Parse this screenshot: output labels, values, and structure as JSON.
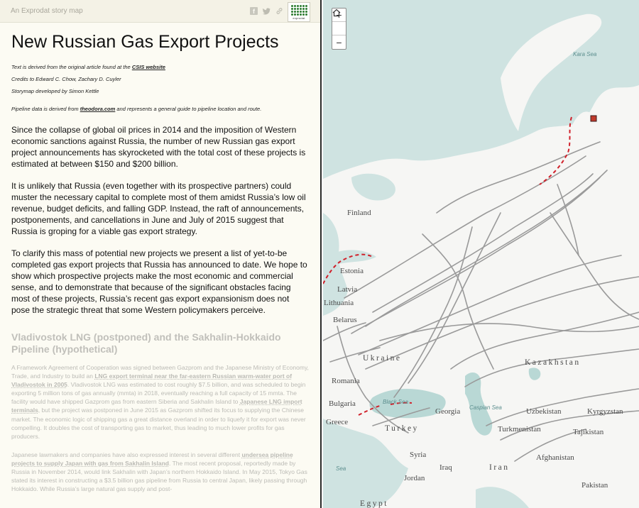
{
  "header": {
    "brand": "An Exprodat story map",
    "share_icons": [
      "facebook-icon",
      "twitter-icon",
      "link-icon"
    ],
    "logo_text": "exprodat"
  },
  "story": {
    "title": "New Russian Gas Export Projects",
    "credit_lines": {
      "source_prefix": "Text is derived from the original article found at the ",
      "source_link": "CSIS website",
      "credits": "Credits to Edward C. Chow, Zachary D. Cuyler",
      "developer": "Storymap developed by Simon Kettle"
    },
    "pipeline_note": {
      "prefix": "Pipeline data is derived from ",
      "link": "theodora.com",
      "suffix": " and represents a general guide to pipeline location and route."
    },
    "paragraphs": [
      "Since the collapse of global oil prices in 2014 and the imposition of Western economic sanctions against Russia, the number of new Russian gas export project announcements has skyrocketed with the total cost of these projects is estimated at between $150 and $200 billion.",
      "It is unlikely that Russia (even together with its prospective partners) could muster the necessary capital to complete most of them amidst Russia’s low oil revenue, budget deficits, and falling GDP. Instead, the raft of announcements, postponements, and cancellations in June and July of 2015 suggest that Russia is groping for a viable gas export strategy.",
      "To clarify this mass of potential new projects we present a list of yet-to-be completed gas export projects that Russia has announced to date. We hope to show which prospective projects make the most economic and commercial sense, and to demonstrate that because of the significant obstacles facing most of these projects, Russia’s recent gas export expansionism does not pose the strategic threat that some Western policymakers perceive."
    ],
    "section": {
      "title": "Vladivostok LNG (postponed) and the Sakhalin-Hokkaido Pipeline (hypothetical)",
      "p1": {
        "a": "A Framework Agreement of Cooperation was signed between Gazprom and the Japanese Ministry of Economy, Trade, and Industry to build an ",
        "link1": "LNG export terminal near the far-eastern Russian warm-water port of Vladivostok in 2005",
        "b": ". Vladivostok LNG was estimated to cost roughly $7.5 billion, and was scheduled to begin exporting 5 million tons of gas annually (mmta) in 2018, eventually reaching a full capacity of 15 mmta. The facility would have shipped Gazprom gas from eastern Siberia and Sakhalin Island to ",
        "link2": "Japanese LNG import terminals",
        "c": ", but the project was postponed in June 2015 as Gazprom shifted its focus to supplying the Chinese market. The economic logic of shipping gas a great distance overland in order to liquefy it for export was never compelling. It doubles the cost of transporting gas to market, thus leading to much lower profits for gas producers."
      },
      "p2": {
        "a": "Japanese lawmakers and companies have also expressed interest in several different ",
        "link1": "undersea pipeline projects to supply Japan with gas from Sakhalin Island",
        "b": ". The most recent proposal, reportedly made by Russia in November 2014, would link Sakhalin with Japan’s northern Hokkaido Island. In May 2015, Tokyo Gas stated its interest in constructing a $3.5 billion gas pipeline from Russia to central Japan, likely passing through Hokkaido. While Russia’s large natural gas supply and post-"
      }
    }
  },
  "map": {
    "zoom_in": "+",
    "home_icon": "home-icon",
    "zoom_out": "−",
    "labels": {
      "kara_sea": "Kara Sea",
      "finland": "Finland",
      "estonia": "Estonia",
      "latvia": "Latvia",
      "lithuania": "Lithuania",
      "belarus": "Belarus",
      "ukraine": "Ukraine",
      "kazakhstan": "Kazakhstan",
      "romania": "Romania",
      "bulgaria": "Bulgaria",
      "black_sea": "Black Sea",
      "caspian_sea": "Caspian Sea",
      "greece": "Greece",
      "turkey": "Turkey",
      "georgia": "Georgia",
      "uzbekistan": "Uzbekistan",
      "kyrgyzstan": "Kyrgyzstan",
      "turkmenistan": "Turkmenistan",
      "tajikistan": "Tajikistan",
      "syria": "Syria",
      "iraq": "Iraq",
      "iran": "Iran",
      "afghanistan": "Afghanistan",
      "jordan": "Jordan",
      "pakistan": "Pakistan",
      "egypt": "Egypt",
      "sea": "Sea"
    },
    "colors": {
      "water": "#cfe3e1",
      "land": "#f6f6f4",
      "pipeline": "#9a9a9a",
      "planned_route": "#d0202a",
      "marker": "#c0392b"
    }
  }
}
